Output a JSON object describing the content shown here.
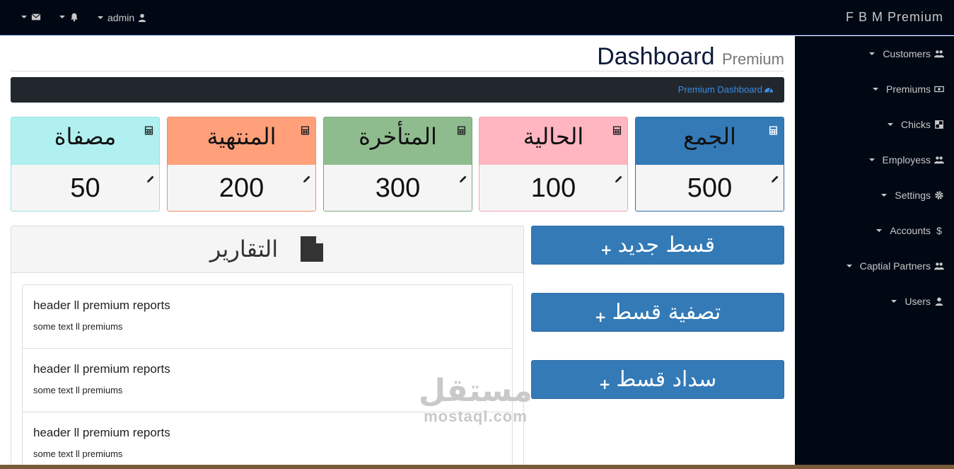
{
  "topbar": {
    "brand": "F B M Premium",
    "user": "admin"
  },
  "sidebar": {
    "items": [
      {
        "label": "Customers",
        "icon": "users-icon"
      },
      {
        "label": "Premiums",
        "icon": "money-icon"
      },
      {
        "label": "Chicks",
        "icon": "squares-icon"
      },
      {
        "label": "Employess",
        "icon": "users-icon"
      },
      {
        "label": "Settings",
        "icon": "gear-icon"
      },
      {
        "label": "Accounts",
        "icon": "dollar-icon"
      },
      {
        "label": "Captial Partners",
        "icon": "users-icon"
      },
      {
        "label": "Users",
        "icon": "user-icon"
      }
    ]
  },
  "header": {
    "title": "Dashboard",
    "subtitle": "Premium"
  },
  "breadcrumb": {
    "label": "Premium Dashboard"
  },
  "cards": [
    {
      "title": "الجمع",
      "value": "500",
      "bg": "#337ab7",
      "border": "#2e6da4"
    },
    {
      "title": "الحالية",
      "value": "100",
      "bg": "#ffb6c1",
      "border": "#f4a3b0"
    },
    {
      "title": "المتأخرة",
      "value": "300",
      "bg": "#8fbc8f",
      "border": "#7aa87a"
    },
    {
      "title": "المنتهية",
      "value": "200",
      "bg": "#ffa07a",
      "border": "#f08c66"
    },
    {
      "title": "مصفاة",
      "value": "50",
      "bg": "#b0f0f0",
      "border": "#9ae0e6"
    }
  ],
  "reports": {
    "title": "التقارير",
    "items": [
      {
        "header": "header ll premium reports",
        "text": "some text ll premiums"
      },
      {
        "header": "header ll premium reports",
        "text": "some text ll premiums"
      },
      {
        "header": "header ll premium reports",
        "text": "some text ll premiums"
      }
    ]
  },
  "actions": [
    {
      "label": "قسط جديد"
    },
    {
      "label": "تصفية قسط"
    },
    {
      "label": "سداد قسط"
    }
  ],
  "watermark": {
    "arabic": "مستقل",
    "latin": "mostaql.com"
  }
}
